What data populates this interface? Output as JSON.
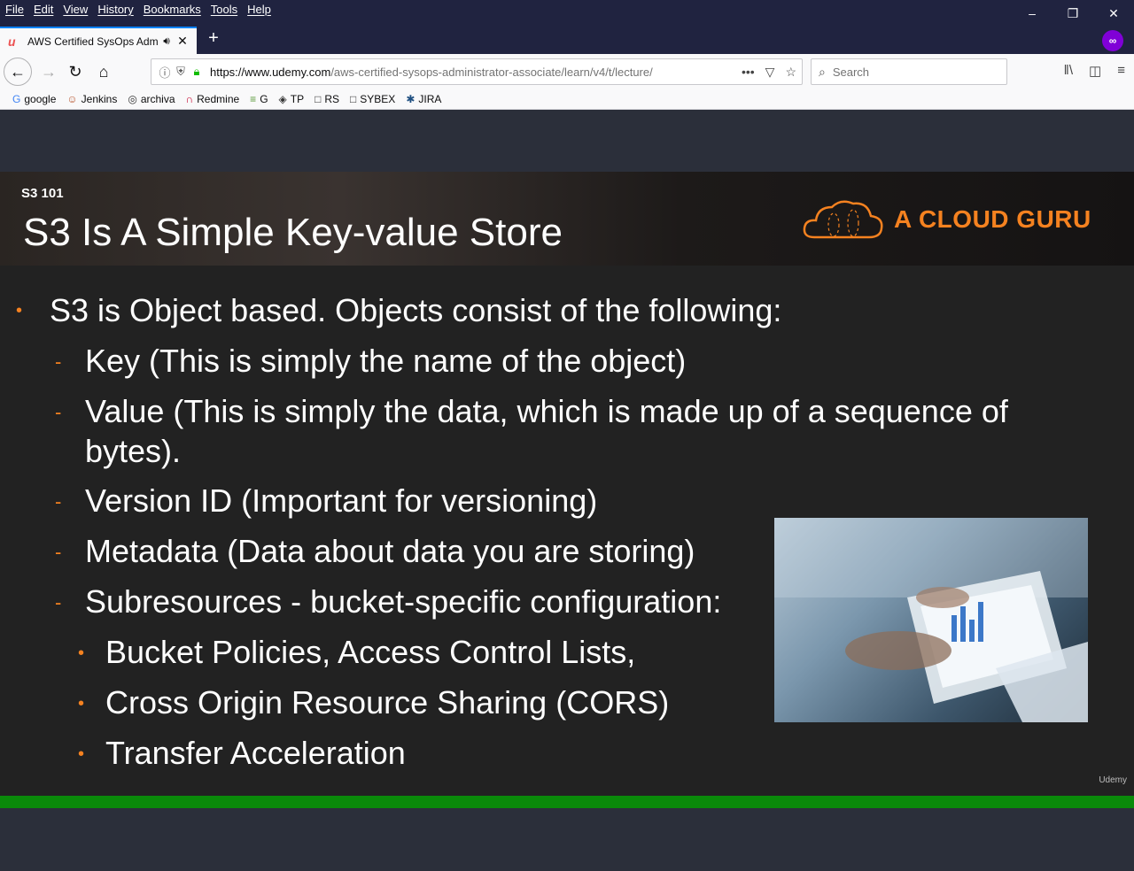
{
  "menubar": {
    "items": [
      "File",
      "Edit",
      "View",
      "History",
      "Bookmarks",
      "Tools",
      "Help"
    ],
    "controls": {
      "minimize": "–",
      "restore": "❐",
      "close": "✕"
    }
  },
  "tab": {
    "title": "AWS Certified SysOps Admi",
    "favicon": "udemy-icon",
    "new_tab": "+"
  },
  "nav": {
    "url_domain": "https://www.udemy.com",
    "url_path": "/aws-certified-sysops-administrator-associate/learn/v4/t/lecture/",
    "search_placeholder": "Search",
    "actions_dots": "•••"
  },
  "bookmarks": [
    {
      "label": "google",
      "icon": "google-icon",
      "glyph": "G",
      "color": "#4285f4"
    },
    {
      "label": "Jenkins",
      "icon": "jenkins-icon",
      "glyph": "☺",
      "color": "#b8562f"
    },
    {
      "label": "archiva",
      "icon": "globe-icon",
      "glyph": "◎",
      "color": "#333333"
    },
    {
      "label": "Redmine",
      "icon": "redmine-icon",
      "glyph": "∩",
      "color": "#c4002b"
    },
    {
      "label": "G",
      "icon": "dxg-icon",
      "glyph": "≡",
      "color": "#5a9a3a"
    },
    {
      "label": "TP",
      "icon": "tp-icon",
      "glyph": "◈",
      "color": "#333333"
    },
    {
      "label": "RS",
      "icon": "folder-icon",
      "glyph": "□",
      "color": "#333333"
    },
    {
      "label": "SYBEX",
      "icon": "folder-icon",
      "glyph": "□",
      "color": "#333333"
    },
    {
      "label": "JIRA",
      "icon": "jira-icon",
      "glyph": "✱",
      "color": "#205081"
    }
  ],
  "slide": {
    "section": "S3 101",
    "title": "S3 Is A Simple Key-value Store",
    "logo_text": "A CLOUD GURU",
    "watermark": "Udemy",
    "bullet_main": "S3 is Object based. Objects consist of the following:",
    "sub": [
      "Key (This is simply the name of the object)",
      "Value (This is simply the data, which is made up of a sequence of",
      "bytes).",
      "Version ID (Important for versioning)",
      "Metadata (Data about data you are storing)",
      "Subresources - bucket-specific configuration:"
    ],
    "subsub": [
      "Bucket Policies, Access Control Lists,",
      "Cross Origin Resource Sharing (CORS)",
      "Transfer Acceleration"
    ],
    "accent": "#f58220"
  }
}
